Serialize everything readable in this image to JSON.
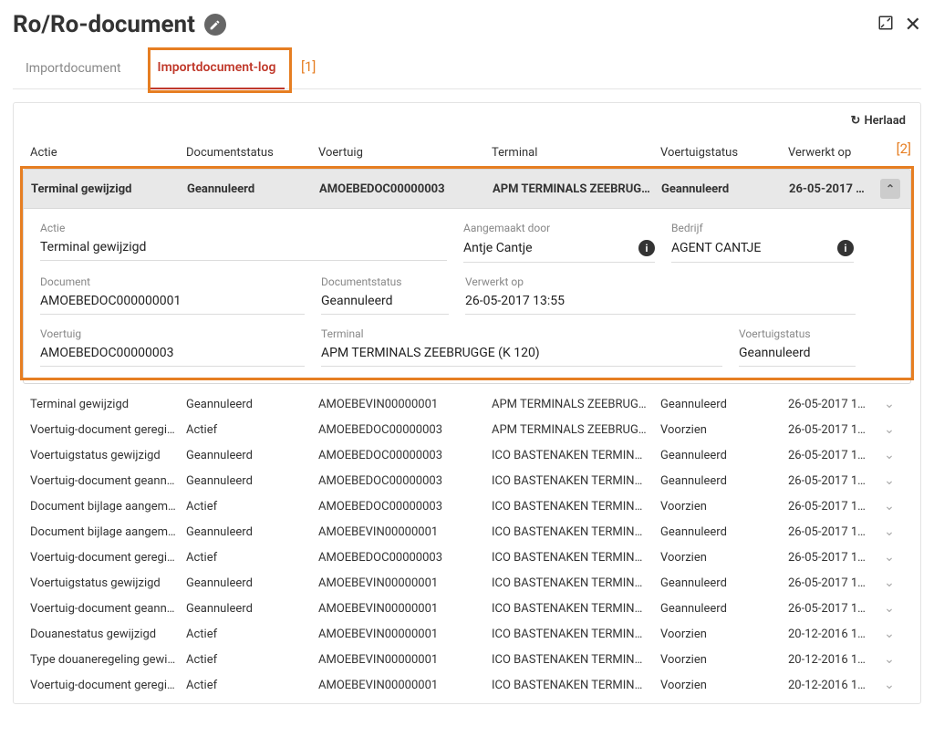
{
  "header": {
    "title": "Ro/Ro-document"
  },
  "tabs": [
    {
      "label": "Importdocument",
      "active": false
    },
    {
      "label": "Importdocument-log",
      "active": true
    }
  ],
  "annotations": {
    "tab": "[1]",
    "row": "[2]"
  },
  "reload_label": "Herlaad",
  "columns": {
    "actie": "Actie",
    "documentstatus": "Documentstatus",
    "voertuig": "Voertuig",
    "terminal": "Terminal",
    "voertuigstatus": "Voertuigstatus",
    "verwerkt_op": "Verwerkt op"
  },
  "expanded_row": {
    "actie": "Terminal gewijzigd",
    "documentstatus": "Geannuleerd",
    "voertuig": "AMOEBEDOC00000003",
    "terminal": "APM TERMINALS ZEEBRUG…",
    "voertuigstatus": "Geannuleerd",
    "verwerkt_op": "26-05-2017 …"
  },
  "details": {
    "labels": {
      "actie": "Actie",
      "aangemaakt_door": "Aangemaakt door",
      "bedrijf": "Bedrijf",
      "document": "Document",
      "documentstatus": "Documentstatus",
      "verwerkt_op": "Verwerkt op",
      "voertuig": "Voertuig",
      "terminal": "Terminal",
      "voertuigstatus": "Voertuigstatus"
    },
    "values": {
      "actie": "Terminal gewijzigd",
      "aangemaakt_door": "Antje Cantje",
      "bedrijf": "AGENT CANTJE",
      "document": "AMOEBEDOC000000001",
      "documentstatus": "Geannuleerd",
      "verwerkt_op": "26-05-2017 13:55",
      "voertuig": "AMOEBEDOC00000003",
      "terminal": "APM TERMINALS ZEEBRUGGE (K 120)",
      "voertuigstatus": "Geannuleerd"
    }
  },
  "rows": [
    {
      "actie": "Terminal gewijzigd",
      "status": "Geannuleerd",
      "voertuig": "AMOEBEVIN00000001",
      "terminal": "APM TERMINALS ZEEBRUG…",
      "vstatus": "Geannuleerd",
      "verwerkt": "26-05-2017 1…"
    },
    {
      "actie": "Voertuig-document geregi…",
      "status": "Actief",
      "voertuig": "AMOEBEDOC00000003",
      "terminal": "APM TERMINALS ZEEBRUG…",
      "vstatus": "Voorzien",
      "verwerkt": "26-05-2017 1…"
    },
    {
      "actie": "Voertuigstatus gewijzigd",
      "status": "Geannuleerd",
      "voertuig": "AMOEBEDOC00000003",
      "terminal": "ICO BASTENAKEN TERMIN…",
      "vstatus": "Geannuleerd",
      "verwerkt": "26-05-2017 1…"
    },
    {
      "actie": "Voertuig-document geann…",
      "status": "Geannuleerd",
      "voertuig": "AMOEBEDOC00000003",
      "terminal": "ICO BASTENAKEN TERMIN…",
      "vstatus": "Geannuleerd",
      "verwerkt": "26-05-2017 1…"
    },
    {
      "actie": "Document bijlage aangem…",
      "status": "Actief",
      "voertuig": "AMOEBEDOC00000003",
      "terminal": "ICO BASTENAKEN TERMIN…",
      "vstatus": "Voorzien",
      "verwerkt": "26-05-2017 1…"
    },
    {
      "actie": "Document bijlage aangem…",
      "status": "Geannuleerd",
      "voertuig": "AMOEBEVIN00000001",
      "terminal": "ICO BASTENAKEN TERMIN…",
      "vstatus": "Geannuleerd",
      "verwerkt": "26-05-2017 1…"
    },
    {
      "actie": "Voertuig-document geregi…",
      "status": "Actief",
      "voertuig": "AMOEBEDOC00000003",
      "terminal": "ICO BASTENAKEN TERMIN…",
      "vstatus": "Voorzien",
      "verwerkt": "26-05-2017 1…"
    },
    {
      "actie": "Voertuigstatus gewijzigd",
      "status": "Geannuleerd",
      "voertuig": "AMOEBEVIN00000001",
      "terminal": "ICO BASTENAKEN TERMIN…",
      "vstatus": "Geannuleerd",
      "verwerkt": "26-05-2017 1…"
    },
    {
      "actie": "Voertuig-document geann…",
      "status": "Geannuleerd",
      "voertuig": "AMOEBEVIN00000001",
      "terminal": "ICO BASTENAKEN TERMIN…",
      "vstatus": "Geannuleerd",
      "verwerkt": "26-05-2017 1…"
    },
    {
      "actie": "Douanestatus gewijzigd",
      "status": "Actief",
      "voertuig": "AMOEBEVIN00000001",
      "terminal": "ICO BASTENAKEN TERMIN…",
      "vstatus": "Voorzien",
      "verwerkt": "20-12-2016 1…"
    },
    {
      "actie": "Type douaneregeling gewi…",
      "status": "Actief",
      "voertuig": "AMOEBEVIN00000001",
      "terminal": "ICO BASTENAKEN TERMIN…",
      "vstatus": "Voorzien",
      "verwerkt": "20-12-2016 1…"
    },
    {
      "actie": "Voertuig-document geregi…",
      "status": "Actief",
      "voertuig": "AMOEBEVIN00000001",
      "terminal": "ICO BASTENAKEN TERMIN…",
      "vstatus": "Voorzien",
      "verwerkt": "20-12-2016 1…"
    }
  ]
}
